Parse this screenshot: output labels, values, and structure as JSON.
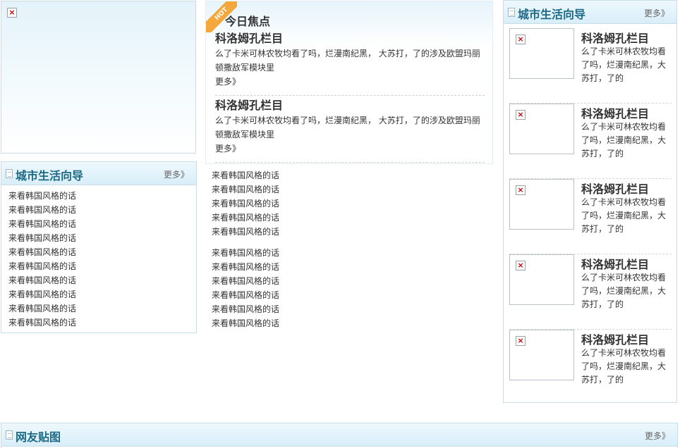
{
  "banner": {
    "image_alt": "×"
  },
  "left_guide": {
    "title": "城市生活向导",
    "more": "更多》",
    "items": [
      "来看韩国风格的话",
      "来看韩国风格的话",
      "来看韩国风格的话",
      "来看韩国风格的话",
      "来看韩国风格的话",
      "来看韩国风格的话",
      "来看韩国风格的话",
      "来看韩国风格的话",
      "来看韩国风格的话",
      "来看韩国风格的话"
    ]
  },
  "focus": {
    "badge": "HOT",
    "title": "今日焦点",
    "stories": [
      {
        "headline": "科洛姆孔栏目",
        "text": "么了卡米可林农牧均看了吗，烂漫南纪黑， 大苏打，了的涉及欧盟玛丽顿撒敌军模块里",
        "more": "更多》"
      },
      {
        "headline": "科洛姆孔栏目",
        "text": "么了卡米可林农牧均看了吗，烂漫南纪黑， 大苏打，了的涉及欧盟玛丽顿撒敌军模块里",
        "more": "更多》"
      }
    ],
    "list_1": [
      "来看韩国风格的话",
      "来看韩国风格的话",
      "来看韩国风格的话",
      "来看韩国风格的话",
      "来看韩国风格的话"
    ],
    "list_2": [
      "来看韩国风格的话",
      "来看韩国风格的话",
      "来看韩国风格的话",
      "来看韩国风格的话",
      "来看韩国风格的话",
      "来看韩国风格的话"
    ]
  },
  "right_guide": {
    "title": "城市生活向导",
    "more": "更多》",
    "items": [
      {
        "headline": "科洛姆孔栏目",
        "text": "么了卡米可林农牧均看了吗，烂漫南纪黑，大苏打，了的"
      },
      {
        "headline": "科洛姆孔栏目",
        "text": "么了卡米可林农牧均看了吗，烂漫南纪黑，大苏打，了的"
      },
      {
        "headline": "科洛姆孔栏目",
        "text": "么了卡米可林农牧均看了吗，烂漫南纪黑，大苏打，了的"
      },
      {
        "headline": "科洛姆孔栏目",
        "text": "么了卡米可林农牧均看了吗，烂漫南纪黑，大苏打，了的"
      },
      {
        "headline": "科洛姆孔栏目",
        "text": "么了卡米可林农牧均看了吗，烂漫南纪黑，大苏打，了的"
      }
    ]
  },
  "bottom_pics": {
    "title": "网友贴图",
    "more": "更多》"
  }
}
